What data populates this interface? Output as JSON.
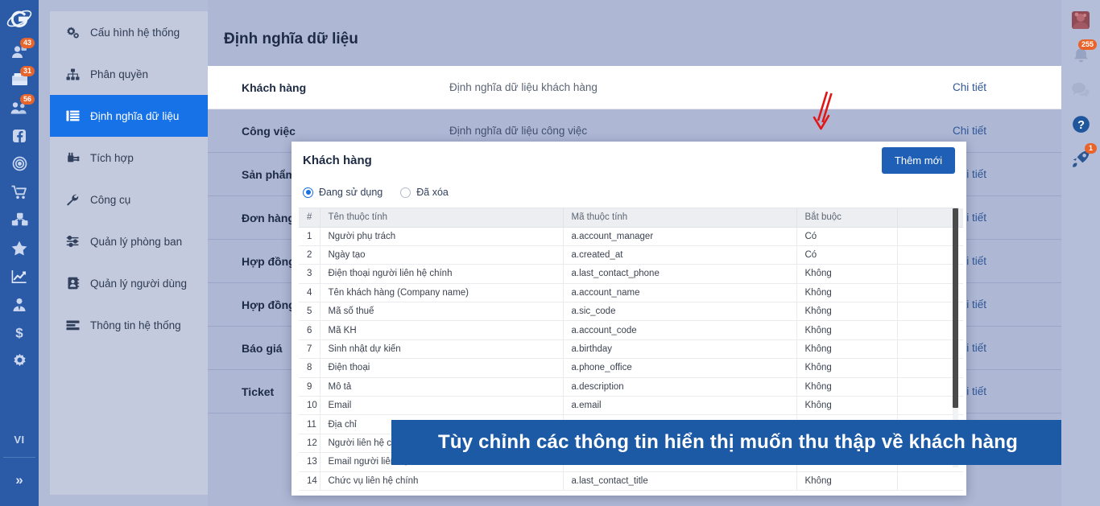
{
  "left_rail": {
    "logo": "galaxy-logo-icon",
    "icons": [
      {
        "name": "user-contact-icon",
        "badge": "43"
      },
      {
        "name": "inbox-mail-icon",
        "badge": "31"
      },
      {
        "name": "team-users-icon",
        "badge": "56"
      },
      {
        "name": "facebook-icon",
        "badge": ""
      },
      {
        "name": "target-icon",
        "badge": ""
      },
      {
        "name": "shopping-cart-icon",
        "badge": ""
      },
      {
        "name": "boxes-product-icon",
        "badge": ""
      },
      {
        "name": "star-icon",
        "badge": ""
      },
      {
        "name": "chart-line-icon",
        "badge": ""
      },
      {
        "name": "person-tie-icon",
        "badge": ""
      },
      {
        "name": "dollar-icon",
        "badge": ""
      },
      {
        "name": "gear-icon",
        "badge": ""
      }
    ],
    "language": "VI",
    "expand": "»"
  },
  "sidebar": {
    "items": [
      {
        "label": "Cấu hình hệ thống",
        "icon": "gears-icon",
        "active": false
      },
      {
        "label": "Phân quyền",
        "icon": "sitemap-icon",
        "active": false
      },
      {
        "label": "Định nghĩa dữ liệu",
        "icon": "list-icon",
        "active": true
      },
      {
        "label": "Tích hợp",
        "icon": "plug-icon",
        "active": false
      },
      {
        "label": "Công cụ",
        "icon": "wrench-icon",
        "active": false
      },
      {
        "label": "Quản lý phòng ban",
        "icon": "sliders-icon",
        "active": false
      },
      {
        "label": "Quản lý người dùng",
        "icon": "address-book-icon",
        "active": false
      },
      {
        "label": "Thông tin hệ thống",
        "icon": "server-info-icon",
        "active": false
      }
    ]
  },
  "main": {
    "page_title": "Định nghĩa dữ liệu",
    "rows": [
      {
        "name": "Khách hàng",
        "desc": "Định nghĩa dữ liệu khách hàng",
        "link": "Chi tiết"
      },
      {
        "name": "Công việc",
        "desc": "Định nghĩa dữ liệu công việc",
        "link": "Chi tiết"
      },
      {
        "name": "Sản phẩm",
        "desc": "",
        "link": "Chi tiết"
      },
      {
        "name": "Đơn hàng",
        "desc": "",
        "link": "Chi tiết"
      },
      {
        "name": "Hợp đồng",
        "desc": "",
        "link": "Chi tiết"
      },
      {
        "name": "Hợp đồng",
        "desc": "",
        "link": "Chi tiết"
      },
      {
        "name": "Báo giá",
        "desc": "",
        "link": "Chi tiết"
      },
      {
        "name": "Ticket",
        "desc": "",
        "link": "Chi tiết"
      }
    ]
  },
  "modal": {
    "title": "Khách hàng",
    "add_button": "Thêm mới",
    "filters": [
      {
        "label": "Đang sử dụng",
        "selected": true
      },
      {
        "label": "Đã xóa",
        "selected": false
      }
    ],
    "table": {
      "columns": [
        "#",
        "Tên thuộc tính",
        "Mã thuộc tính",
        "Bắt buộc",
        ""
      ],
      "rows": [
        {
          "num": "1",
          "name": "Người phụ trách",
          "code": "a.account_manager",
          "required": "Có"
        },
        {
          "num": "2",
          "name": "Ngày tạo",
          "code": "a.created_at",
          "required": "Có"
        },
        {
          "num": "3",
          "name": "Điện thoại người liên hệ chính",
          "code": "a.last_contact_phone",
          "required": "Không"
        },
        {
          "num": "4",
          "name": "Tên khách hàng (Company name)",
          "code": "a.account_name",
          "required": "Không"
        },
        {
          "num": "5",
          "name": "Mã số thuế",
          "code": "a.sic_code",
          "required": "Không"
        },
        {
          "num": "6",
          "name": "Mã KH",
          "code": "a.account_code",
          "required": "Không"
        },
        {
          "num": "7",
          "name": "Sinh nhật dự kiến",
          "code": "a.birthday",
          "required": "Không"
        },
        {
          "num": "8",
          "name": "Điện thoại",
          "code": "a.phone_office",
          "required": "Không"
        },
        {
          "num": "9",
          "name": "Mô tả",
          "code": "a.description",
          "required": "Không"
        },
        {
          "num": "10",
          "name": "Email",
          "code": "a.email",
          "required": "Không"
        },
        {
          "num": "11",
          "name": "Địa chỉ",
          "code": "",
          "required": ""
        },
        {
          "num": "12",
          "name": "Người liên hệ chính",
          "code": "",
          "required": ""
        },
        {
          "num": "13",
          "name": "Email người liên hệ chính",
          "code": "",
          "required": ""
        },
        {
          "num": "14",
          "name": "Chức vụ liên hệ chính",
          "code": "a.last_contact_title",
          "required": "Không"
        }
      ]
    }
  },
  "caption": {
    "text": "Tùy chỉnh các thông tin hiển thị muốn thu thập về khách hàng"
  },
  "right_rail": {
    "icons": [
      {
        "name": "avatar-icon",
        "badge": ""
      },
      {
        "name": "bell-notification-icon",
        "badge": "255"
      },
      {
        "name": "chat-bubble-icon",
        "badge": ""
      },
      {
        "name": "help-question-icon",
        "badge": ""
      },
      {
        "name": "rocket-icon",
        "badge": "1"
      }
    ]
  },
  "colors": {
    "rail_blue": "#2b5aa7",
    "accent_blue": "#1772e8",
    "button_blue": "#1f5fb5",
    "banner_blue": "#1c5aa5",
    "badge_orange": "#e8642a",
    "page_bg": "#aeb8d4",
    "annotation_red": "#e11717"
  }
}
